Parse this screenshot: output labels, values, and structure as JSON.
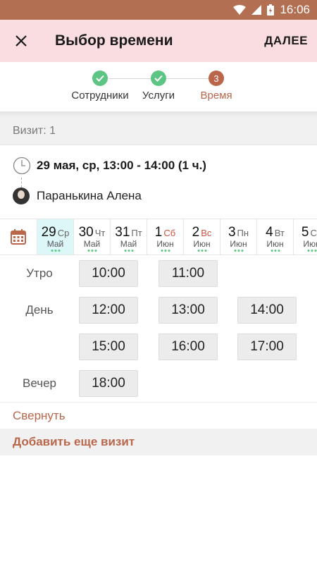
{
  "status_bar": {
    "time": "16:06",
    "icons": [
      "wifi-icon",
      "signal-icon",
      "battery-icon"
    ]
  },
  "toolbar": {
    "title": "Выбор времени",
    "next_label": "ДАЛЕЕ",
    "close_icon": "close-icon"
  },
  "stepper": {
    "steps": [
      {
        "label": "Сотрудники",
        "state": "done"
      },
      {
        "label": "Услуги",
        "state": "done"
      },
      {
        "label": "Время",
        "state": "active",
        "number": "3"
      }
    ]
  },
  "visit": {
    "header": "Визит: 1",
    "datetime": "29 мая, ср, 13:00 - 14:00 (1 ч.)",
    "employee": "Паранькина Алена"
  },
  "dates": [
    {
      "num": "29",
      "weekday": "Ср",
      "month": "Май",
      "selected": true,
      "weekend": false
    },
    {
      "num": "30",
      "weekday": "Чт",
      "month": "Май",
      "selected": false,
      "weekend": false
    },
    {
      "num": "31",
      "weekday": "Пт",
      "month": "Май",
      "selected": false,
      "weekend": false
    },
    {
      "num": "1",
      "weekday": "Сб",
      "month": "Июн",
      "selected": false,
      "weekend": true
    },
    {
      "num": "2",
      "weekday": "Вс",
      "month": "Июн",
      "selected": false,
      "weekend": true
    },
    {
      "num": "3",
      "weekday": "Пн",
      "month": "Июн",
      "selected": false,
      "weekend": false
    },
    {
      "num": "4",
      "weekday": "Вт",
      "month": "Июн",
      "selected": false,
      "weekend": false
    },
    {
      "num": "5",
      "weekday": "Ср",
      "month": "Июн",
      "selected": false,
      "weekend": false
    }
  ],
  "periods": {
    "morning": "Утро",
    "day": "День",
    "evening": "Вечер"
  },
  "slots": {
    "morning": [
      "10:00",
      "11:00"
    ],
    "day": [
      "12:00",
      "13:00",
      "14:00",
      "15:00",
      "16:00",
      "17:00"
    ],
    "evening": [
      "18:00"
    ]
  },
  "actions": {
    "collapse": "Свернуть",
    "add_visit": "Добавить еще визит"
  },
  "colors": {
    "accent": "#b9664b",
    "status_bar": "#b26f52",
    "toolbar": "#fadde0",
    "done": "#5cc584",
    "selected_day": "#ddf6f8"
  }
}
